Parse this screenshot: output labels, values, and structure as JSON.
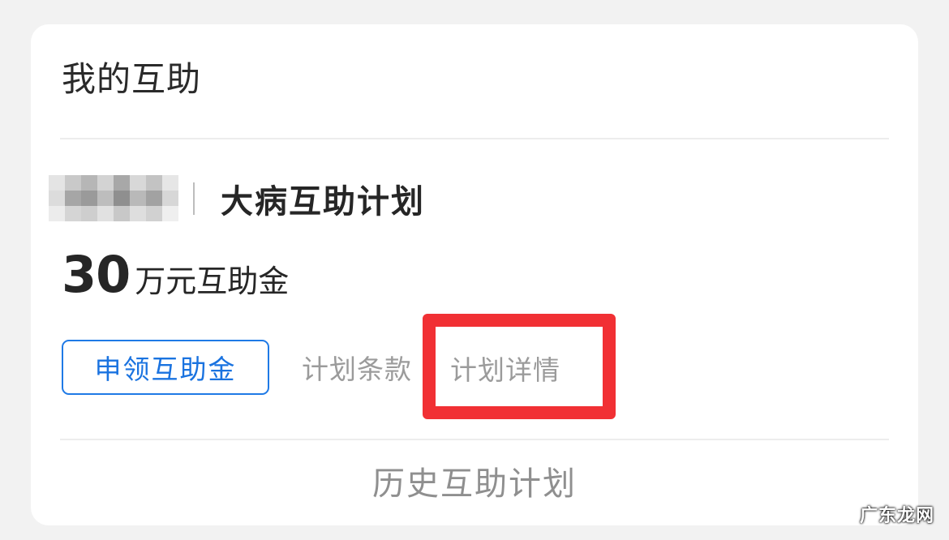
{
  "card": {
    "title": "我的互助"
  },
  "plan": {
    "name": "大病互助计划",
    "amount_value": "30",
    "amount_unit": "万元互助金"
  },
  "actions": {
    "claim_label": "申领互助金",
    "terms_label": "计划条款",
    "details_label": "计划详情"
  },
  "footer": {
    "history_label": "历史互助计划"
  },
  "watermark": {
    "text": "广东龙网"
  },
  "colors": {
    "accent_blue": "#1a73e0",
    "highlight_red": "#f13034",
    "muted_text": "#9b9b9b"
  }
}
